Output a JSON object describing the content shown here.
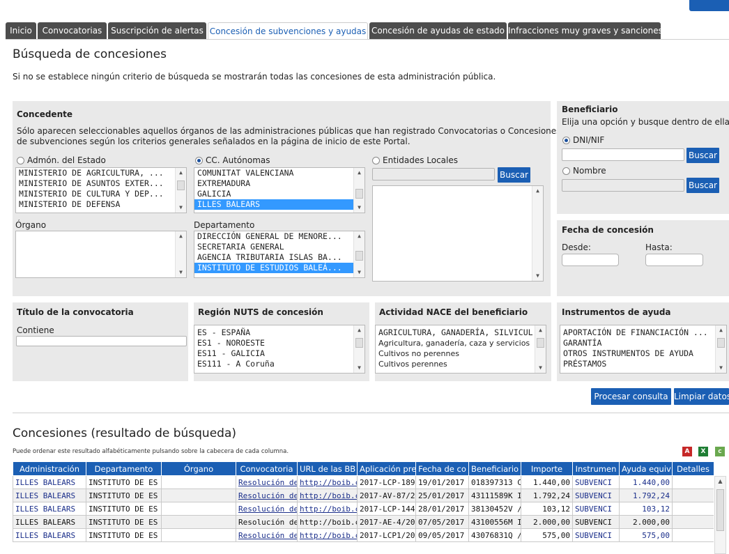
{
  "tabs": [
    {
      "label": "Inicio"
    },
    {
      "label": "Convocatorias"
    },
    {
      "label": "Suscripción de alertas"
    },
    {
      "label": "Concesión de subvenciones y ayudas"
    },
    {
      "label": "Concesión de ayudas de estado"
    },
    {
      "label": "Infracciones muy graves y sanciones"
    }
  ],
  "active_tab": "Concesión de subvenciones y ayudas",
  "page_title": "Búsqueda de concesiones",
  "intro_text": "Si no se establece ningún criterio de búsqueda se mostrarán todas las concesiones de esta administración pública.",
  "concedente": {
    "title": "Concedente",
    "note_line1": "Sólo aparecen seleccionables aquellos órganos de las administraciones públicas que han registrado Convocatorias o Concesiones",
    "note_line2": "de subvenciones según los criterios generales señalados en la página de inicio de este Portal.",
    "radio_estado": "Admón. del Estado",
    "radio_ccaa": "CC. Autónomas",
    "radio_locales": "Entidades Locales",
    "selected_radio": "CC. Autónomas",
    "estado_options": [
      "MINISTERIO DE AGRICULTURA, ...",
      "MINISTERIO DE ASUNTOS EXTER...",
      "MINISTERIO DE CULTURA Y DEP...",
      "MINISTERIO DE DEFENSA"
    ],
    "ccaa_options": [
      "COMUNITAT VALENCIANA",
      "EXTREMADURA",
      "GALICIA",
      "ILLES BALEARS"
    ],
    "ccaa_selected": "ILLES BALEARS",
    "locales_button": "Buscar",
    "organo_label": "Órgano",
    "departamento_label": "Departamento",
    "departamento_options": [
      "DIRECCIÓN GENERAL DE MENORE...",
      "SECRETARIA GENERAL",
      "AGENCIA TRIBUTARIA ISLAS BA...",
      "INSTITUTO DE ESTUDIOS BALEÁ..."
    ],
    "departamento_selected": "INSTITUTO DE ESTUDIOS BALEÁ..."
  },
  "beneficiario": {
    "title": "Beneficiario",
    "subtitle": "Elija una opción y busque dentro de ella",
    "radio_dni": "DNI/NIF",
    "radio_nombre": "Nombre",
    "selected_radio": "DNI/NIF",
    "button_label": "Buscar"
  },
  "fecha": {
    "title": "Fecha de concesión",
    "desde": "Desde:",
    "hasta": "Hasta:"
  },
  "titulo_convocatoria": {
    "title": "Título de la convocatoria",
    "contiene": "Contiene"
  },
  "region": {
    "title": "Región NUTS de concesión",
    "options": [
      "ES - ESPAÑA",
      "ES1 - NOROESTE",
      "ES11 - GALICIA",
      "ES111 - A Coruña"
    ]
  },
  "actividad": {
    "title": "Actividad NACE del beneficiario",
    "options": [
      "AGRICULTURA, GANADERÍA, SILVICUL",
      "Agricultura, ganadería, caza y servicios",
      "Cultivos no perennes",
      "Cultivos perennes"
    ]
  },
  "instrumentos": {
    "title": "Instrumentos de ayuda",
    "options": [
      "APORTACIÓN DE FINANCIACIÓN ...",
      "GARANTÍA",
      "OTROS INSTRUMENTOS DE AYUDA",
      "PRÉSTAMOS"
    ]
  },
  "actions": {
    "procesar": "Procesar consulta",
    "limpiar": "Limpiar datos"
  },
  "results": {
    "title": "Concesiones (resultado de búsqueda)",
    "hint": "Puede ordenar este resultado alfabéticamente pulsando sobre la cabecera de cada columna.",
    "columns": [
      "Administración",
      "Departamento",
      "Órgano",
      "Convocatoria",
      "URL de las BB",
      "Aplicación pre",
      "Fecha de co",
      "Beneficiario",
      "Importe",
      "Instrumen",
      "Ayuda equiv",
      "Detalles"
    ],
    "rows": [
      [
        "ILLES BALEARS",
        "INSTITUTO DE ES",
        "",
        "Resolución de l",
        "http://boib.cai",
        "2017-LCP-189",
        "19/01/2017",
        "018397313 C",
        "1.440,00",
        "SUBVENCI",
        "1.440,00",
        ""
      ],
      [
        "ILLES BALEARS",
        "INSTITUTO DE ES",
        "",
        "Resolución de l",
        "http://boib.cai",
        "2017-AV-87/2",
        "25/01/2017",
        "43111589K I",
        "1.792,24",
        "SUBVENCI",
        "1.792,24",
        ""
      ],
      [
        "ILLES BALEARS",
        "INSTITUTO DE ES",
        "",
        "Resolución de l",
        "http://boib.cai",
        "2017-LCP-144",
        "28/01/2017",
        "38130452V /",
        "103,12",
        "SUBVENCI",
        "103,12",
        ""
      ],
      [
        "ILLES BALEARS",
        "INSTITUTO DE ES",
        "",
        "Resolución de l",
        "http://boib.cai",
        "2017-AE-4/20",
        "07/05/2017",
        "43100556M I",
        "2.000,00",
        "SUBVENCI",
        "2.000,00",
        ""
      ],
      [
        "ILLES BALEARS",
        "INSTITUTO DE ES",
        "",
        "Resolución de l",
        "http://boib.cai",
        "2017-LCP1/20",
        "09/05/2017",
        "43076831Q /",
        "575,00",
        "SUBVENCI",
        "575,00",
        ""
      ]
    ]
  },
  "export_icons": [
    "pdf-icon",
    "excel-icon",
    "csv-icon"
  ],
  "colors": {
    "accent": "#1b5fb4",
    "tab_dark": "#4d4d4d",
    "panel": "#e9e9e9",
    "selection": "#3399ff"
  }
}
